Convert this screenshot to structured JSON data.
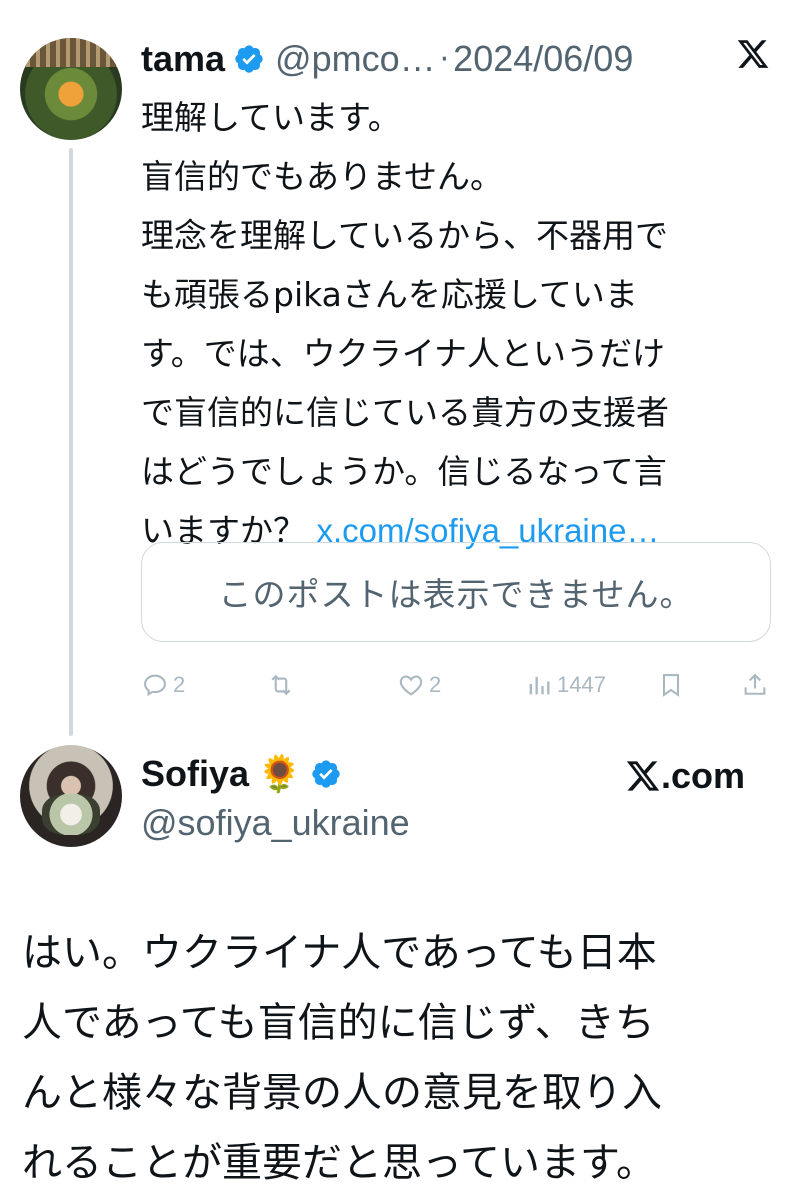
{
  "tweet1": {
    "name": "tama",
    "handle": "@pmco…",
    "separator": "·",
    "date": "2024/06/09",
    "lines": [
      "理解しています。",
      "盲信的でもありません。",
      "理念を理解しているから、不器用で",
      "も頑張るpikaさんを応援していま",
      "す。では、ウクライナ人というだけ",
      "で盲信的に信じている貴方の支援者",
      "はどうでしょうか。信じるなって言",
      "いますか？ "
    ],
    "link": "x.com/sofiya_ukraine…",
    "unavailable_text": "このポストは表示できません。",
    "stats": {
      "replies": "2",
      "retweets": "",
      "likes": "2",
      "views": "1447"
    }
  },
  "tweet2": {
    "name": "Sofiya",
    "emoji": "🌻",
    "handle": "@sofiya_ukraine",
    "source_label": ".com",
    "lines": [
      "はい。ウクライナ人であっても日本",
      "人であっても盲信的に信じず、きち",
      "んと様々な背景の人の意見を取り入",
      "れることが重要だと思っています。"
    ]
  },
  "icons": {
    "verified": "verified-badge-icon",
    "brand": "x-logo-icon",
    "reply": "reply-icon",
    "retweet": "retweet-icon",
    "like": "heart-icon",
    "views": "views-icon",
    "bookmark": "bookmark-icon",
    "share": "share-icon"
  },
  "colors": {
    "text": "#0f1419",
    "secondary": "#536471",
    "link": "#1d9bf0",
    "verified": "#1d9bf0",
    "thread_line": "#cfd9de",
    "action_icons": "#aab8c2"
  }
}
